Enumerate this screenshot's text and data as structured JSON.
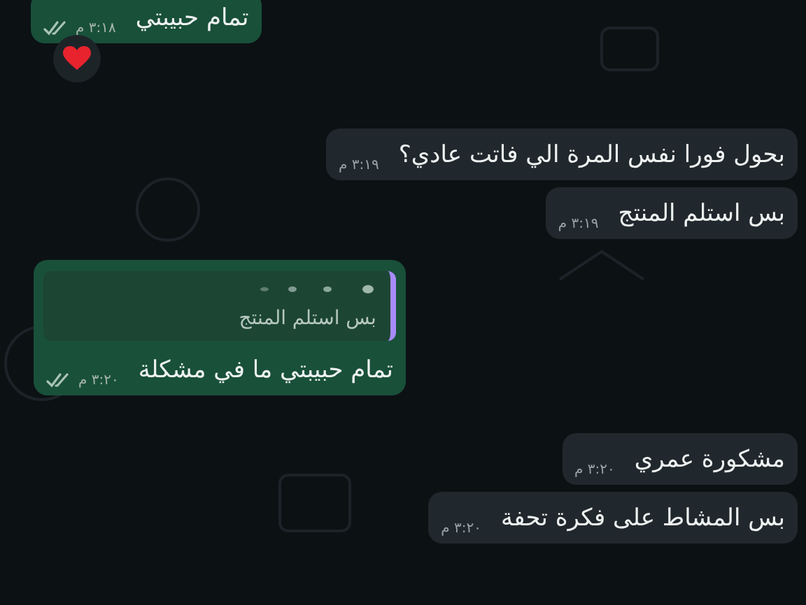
{
  "messages": [
    {
      "kind": "sent",
      "text": "تمام حبيبتي",
      "time": "٣:١٨ م",
      "reacted": true
    },
    {
      "kind": "received",
      "text": "بحول فورا نفس المرة الي فاتت عادي؟",
      "time": "٣:١٩ م",
      "reacted": false
    },
    {
      "kind": "received",
      "text": "بس استلم المنتج",
      "time": "٣:١٩ م",
      "reacted": false
    },
    {
      "kind": "sent",
      "text": "تمام حبيبتي ما في مشكلة",
      "time": "٣:٢٠ م",
      "reacted": false,
      "reply": {
        "text": "بس استلم المنتج"
      }
    },
    {
      "kind": "received",
      "text": "مشكورة عمري",
      "time": "٣:٢٠ م",
      "reacted": false
    },
    {
      "kind": "received",
      "text": "بس المشاط على فكرة تحفة",
      "time": "٣:٢٠ م",
      "reacted": false
    }
  ]
}
